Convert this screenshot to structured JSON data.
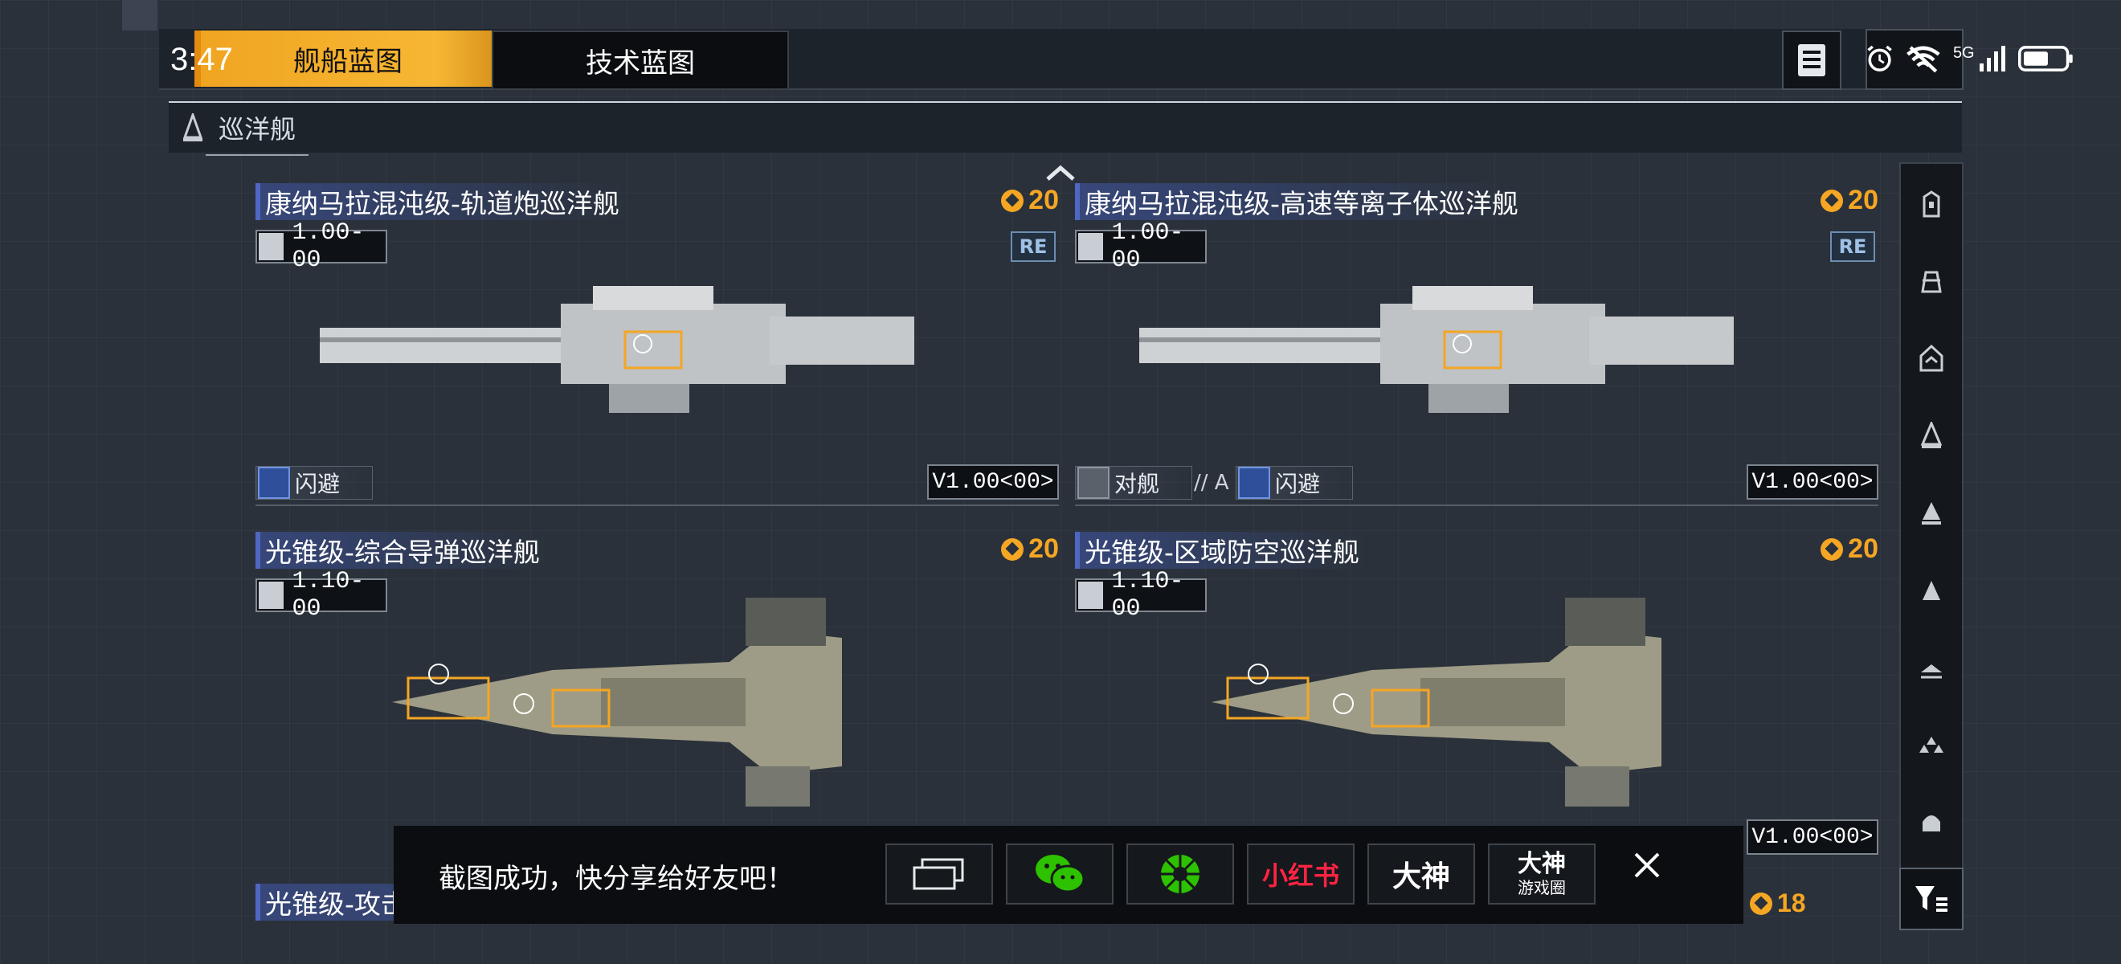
{
  "status_bar": {
    "time": "3:47",
    "network": "5G"
  },
  "tabs": {
    "ship_blueprint": "舰船蓝图",
    "tech_blueprint": "技术蓝图"
  },
  "category": {
    "label": "巡洋舰"
  },
  "cards": [
    {
      "title": "康纳马拉混沌级-轨道炮巡洋舰",
      "cost": "20",
      "version": "1.00-00",
      "badge": "RE",
      "tags": [
        "闪避"
      ],
      "vtag": "V1.00<00>"
    },
    {
      "title": "康纳马拉混沌级-高速等离子体巡洋舰",
      "cost": "20",
      "version": "1.00-00",
      "badge": "RE",
      "tags": [
        "对舰",
        "闪避"
      ],
      "separator": "// A",
      "vtag": "V1.00<00>"
    },
    {
      "title": "光锥级-综合导弹巡洋舰",
      "cost": "20",
      "version": "1.10-00"
    },
    {
      "title": "光锥级-区域防空巡洋舰",
      "cost": "20",
      "version": "1.10-00",
      "vtag": "V1.00<00>"
    }
  ],
  "partial_card": {
    "title": "光锥级-攻击导弹巡洋舰",
    "cost": "18"
  },
  "share_toast": {
    "message": "截图成功，快分享给好友吧！",
    "xiaohongshu": "小红书",
    "dashen": "大神",
    "dashen_circle_top": "大神",
    "dashen_circle_bottom": "游戏圈"
  },
  "colors": {
    "accent": "#f5a623",
    "title_bg": "#37477a",
    "wechat": "#2dc100"
  },
  "icons": [
    "document-icon",
    "alarm-icon",
    "wifi-off-icon",
    "signal-icon",
    "battery-icon",
    "up-chevron-icon",
    "filter-icon",
    "close-icon",
    "screen-share-icon",
    "wechat-icon",
    "moments-icon"
  ]
}
